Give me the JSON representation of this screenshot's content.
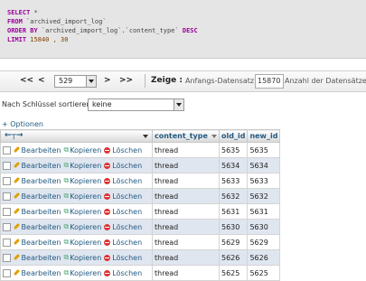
{
  "query": {
    "select": "SELECT",
    "star": "*",
    "from": "FROM",
    "table": "`archived_import_log`",
    "order_by": "ORDER BY",
    "order_col": "`archived_import_log`.`content_type`",
    "desc": "DESC",
    "limit": "LIMIT",
    "limit_val": "15840 , 30"
  },
  "nav": {
    "first": "<<",
    "prev": "<",
    "page": "529",
    "next": ">",
    "last": ">>",
    "show": "Zeige :",
    "start_label": "Anfangs-Datensatz:",
    "start_value": "15870",
    "rows_label": "Anzahl der Datensätze:"
  },
  "sort": {
    "label": "Nach Schlüssel sortieren:",
    "value": "keine"
  },
  "options_label": "+ Optionen",
  "table": {
    "headers": {
      "content_type": "content_type",
      "old_id": "old_id",
      "new_id": "new_id"
    },
    "actions": {
      "edit": "Bearbeiten",
      "copy": "Kopieren",
      "delete": "Löschen"
    },
    "rows": [
      {
        "content_type": "thread",
        "old_id": "5635",
        "new_id": "5635"
      },
      {
        "content_type": "thread",
        "old_id": "5634",
        "new_id": "5634"
      },
      {
        "content_type": "thread",
        "old_id": "5633",
        "new_id": "5633"
      },
      {
        "content_type": "thread",
        "old_id": "5632",
        "new_id": "5632"
      },
      {
        "content_type": "thread",
        "old_id": "5631",
        "new_id": "5631"
      },
      {
        "content_type": "thread",
        "old_id": "5630",
        "new_id": "5630"
      },
      {
        "content_type": "thread",
        "old_id": "5629",
        "new_id": "5629"
      },
      {
        "content_type": "thread",
        "old_id": "5626",
        "new_id": "5626"
      },
      {
        "content_type": "thread",
        "old_id": "5625",
        "new_id": "5625"
      }
    ]
  },
  "colors": {
    "link": "#235a81",
    "keyword": "#990099",
    "row_alt": "#dfe6f0"
  }
}
